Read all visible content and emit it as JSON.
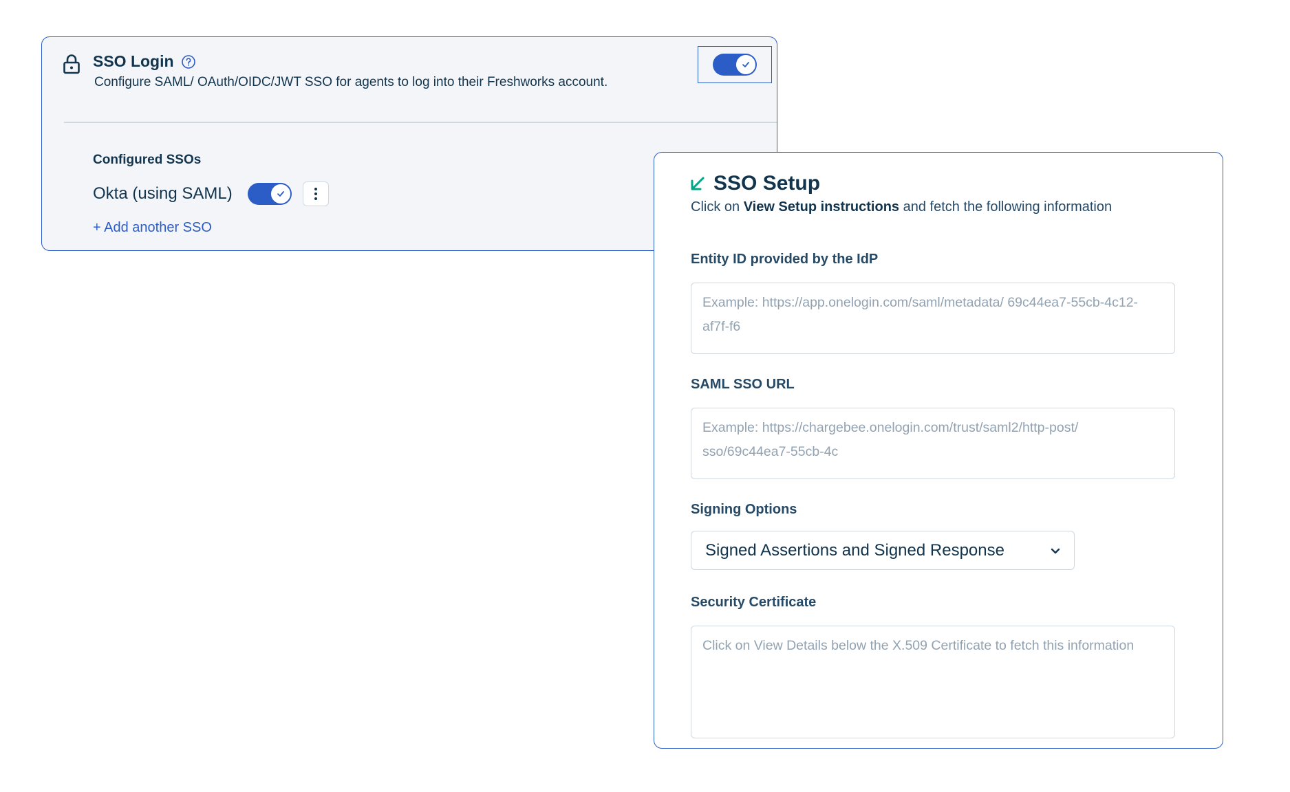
{
  "sso_login": {
    "title": "SSO Login",
    "description": "Configure SAML/ OAuth/OIDC/JWT SSO for agents to log into their Freshworks account.",
    "enabled": true,
    "configured_label": "Configured SSOs",
    "configured_ssos": [
      {
        "name": "Okta (using SAML)",
        "enabled": true
      }
    ],
    "add_another_label": "+ Add another SSO"
  },
  "sso_setup": {
    "title": "SSO Setup",
    "subtitle_prefix": "Click on ",
    "subtitle_bold": "View Setup instructions",
    "subtitle_suffix": " and fetch the following information",
    "fields": {
      "entity_id": {
        "label": "Entity ID provided by the IdP",
        "placeholder": "Example: https://app.onelogin.com/saml/metadata/ 69c44ea7-55cb-4c12-af7f-f6"
      },
      "saml_sso_url": {
        "label": "SAML SSO URL",
        "placeholder": "Example: https://chargebee.onelogin.com/trust/saml2/http-post/ sso/69c44ea7-55cb-4c"
      },
      "signing_options": {
        "label": "Signing Options",
        "selected": "Signed Assertions and Signed Response"
      },
      "security_certificate": {
        "label": "Security Certificate",
        "placeholder": "Click on View Details below the X.509 Certificate to fetch this information"
      }
    }
  },
  "colors": {
    "accent": "#2c5cc5",
    "text_primary": "#12344d",
    "text_placeholder": "#92a2b1",
    "border": "#cfd7df",
    "card_bg": "#f3f5f9",
    "collapse_icon": "#00a886"
  },
  "icons": {
    "lock": "lock-icon",
    "help": "help-circle-icon",
    "check": "check-icon",
    "more": "more-vertical-icon",
    "collapse": "collapse-arrow-icon",
    "chevron": "chevron-down-icon"
  }
}
